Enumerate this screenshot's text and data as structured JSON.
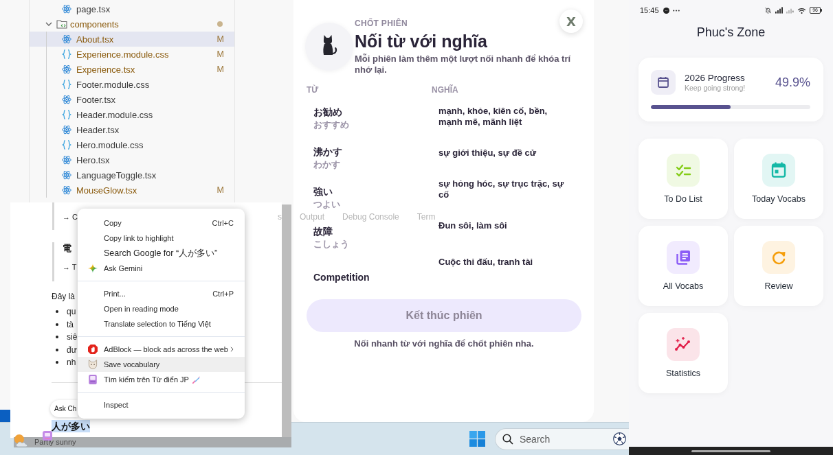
{
  "explorer": {
    "items": [
      {
        "kind": "folder",
        "children": [
          {
            "kind": "react",
            "name": "page.tsx",
            "selected": false
          }
        ]
      },
      {
        "kind": "folder",
        "name": "components",
        "expanded": true,
        "changed": true,
        "selected": false,
        "children": [
          {
            "kind": "react",
            "name": "About.tsx",
            "status": "M",
            "selected": true
          },
          {
            "kind": "css",
            "name": "Experience.module.css",
            "status": "M",
            "selected": false
          },
          {
            "kind": "react",
            "name": "Experience.tsx",
            "status": "M",
            "selected": false
          },
          {
            "kind": "css",
            "name": "Footer.module.css",
            "selected": false
          },
          {
            "kind": "react",
            "name": "Footer.tsx",
            "selected": false
          },
          {
            "kind": "css",
            "name": "Header.module.css",
            "selected": false
          },
          {
            "kind": "react",
            "name": "Header.tsx",
            "selected": false
          },
          {
            "kind": "css",
            "name": "Hero.module.css",
            "selected": false
          },
          {
            "kind": "react",
            "name": "Hero.tsx",
            "selected": false
          },
          {
            "kind": "react",
            "name": "LanguageToggle.tsx",
            "selected": false
          },
          {
            "kind": "react",
            "name": "MouseGlow.tsx",
            "status": "M",
            "selected": false
          }
        ]
      }
    ]
  },
  "panel_tabs": [
    "s",
    "Output",
    "Debug Console",
    "Term"
  ],
  "article": {
    "quotes": [
      {
        "lines": [
          "→ C"
        ]
      },
      {
        "heading": "電",
        "lines": [
          "→ T"
        ]
      }
    ],
    "paragraph": "Đây là",
    "bullets": [
      "qu",
      "tà",
      "siê",
      "đư",
      "nh"
    ],
    "ask_button": "Ask Ch",
    "selection": "人が多い"
  },
  "context_menu": {
    "groups": [
      [
        {
          "label": "Copy",
          "shortcut": "Ctrl+C",
          "highlighted": false
        },
        {
          "label": "Copy link to highlight",
          "highlighted": false
        },
        {
          "label": "Search Google for “人が多い”",
          "highlighted": false
        },
        {
          "label": "Ask Gemini",
          "highlighted": false
        }
      ],
      [
        {
          "label": "Print...",
          "shortcut": "Ctrl+P",
          "highlighted": false
        },
        {
          "label": "Open in reading mode",
          "highlighted": false
        },
        {
          "label": "Translate selection to Tiếng Việt",
          "highlighted": false
        }
      ],
      [
        {
          "label": "AdBlock — block ads across the web",
          "submenu": true,
          "highlighted": false
        },
        {
          "label": "Save vocabulary",
          "highlighted": true
        },
        {
          "label": "Tìm kiếm trên Từ điển JP",
          "highlighted": false
        }
      ],
      [
        {
          "label": "Inspect",
          "highlighted": false
        }
      ]
    ]
  },
  "weather": {
    "label": "Partly sunny"
  },
  "modal": {
    "eyebrow": "CHỐT PHIÊN",
    "title": "Nối từ với nghĩa",
    "subtitle": "Mỗi phiên làm thêm một lượt nối nhanh để khóa trí nhớ lại.",
    "close": "X",
    "columns": [
      "TỪ",
      "NGHĨA"
    ],
    "words": [
      {
        "word": "お勧め",
        "reading": "おすすめ"
      },
      {
        "word": "沸かす",
        "reading": "わかす"
      },
      {
        "word": "強い",
        "reading": "つよい"
      },
      {
        "word": "故障",
        "reading": "こしょう"
      },
      {
        "word": "Competition"
      }
    ],
    "meanings": [
      "mạnh, khỏe, kiên cố, bền, mạnh mẽ, mãnh liệt",
      "sự giới thiệu, sự đề cử",
      "sự hỏng hóc, sự trục trặc, sự cố",
      "Đun sôi, làm sôi",
      "Cuộc thi đấu, tranh tài"
    ],
    "finish_button": {
      "label": "Kết thúc phiên",
      "disabled": true
    },
    "hint": "Nối nhanh từ với nghĩa để chốt phiên nha."
  },
  "taskbar": {
    "search": {
      "placeholder": "Search"
    }
  },
  "phone": {
    "status_bar": {
      "time": "15:45",
      "battery": "96"
    },
    "title": "Phuc's Zone",
    "progress": {
      "title": "2026 Progress",
      "subtitle": "Keep going strong!",
      "value": "49.9%",
      "level": 0.499
    },
    "tiles": [
      {
        "label": "To Do List",
        "color": "#84cc16"
      },
      {
        "label": "Today Vocabs",
        "color": "#14b8a6"
      },
      {
        "label": "All Vocabs",
        "color": "#8b5cf6"
      },
      {
        "label": "Review",
        "color": "#f59e0b"
      },
      {
        "label": "Statistics",
        "color": "#e11d48"
      }
    ]
  }
}
